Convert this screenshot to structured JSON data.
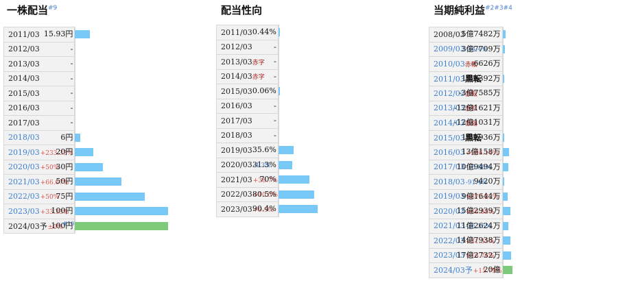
{
  "dividend": {
    "title": "一株配当",
    "title_note": "#9",
    "rows": [
      {
        "year": "2011/03",
        "value": "15.93円",
        "frac": 0.16,
        "blue": false
      },
      {
        "year": "2012/03",
        "value": "-",
        "frac": 0,
        "blue": false
      },
      {
        "year": "2013/03",
        "value": "-",
        "frac": 0,
        "blue": false
      },
      {
        "year": "2014/03",
        "value": "-",
        "frac": 0,
        "blue": false
      },
      {
        "year": "2015/03",
        "value": "-",
        "frac": 0,
        "blue": false
      },
      {
        "year": "2016/03",
        "value": "-",
        "frac": 0,
        "blue": false
      },
      {
        "year": "2017/03",
        "value": "-",
        "frac": 0,
        "blue": false
      },
      {
        "year": "2018/03",
        "value": "6円",
        "frac": 0.06,
        "blue": true
      },
      {
        "year": "2019/03",
        "change": "+233.33%",
        "dir": "up",
        "value": "20円",
        "frac": 0.2,
        "blue": true
      },
      {
        "year": "2020/03",
        "change": "+50%",
        "dir": "up",
        "value": "30円",
        "frac": 0.3,
        "blue": true
      },
      {
        "year": "2021/03",
        "change": "+66.67%",
        "dir": "up",
        "value": "50円",
        "frac": 0.5,
        "blue": true
      },
      {
        "year": "2022/03",
        "change": "+50%",
        "dir": "up",
        "value": "75円",
        "frac": 0.75,
        "blue": true
      },
      {
        "year": "2023/03",
        "change": "+33.33%",
        "dir": "up",
        "value": "100円",
        "frac": 1.0,
        "blue": true
      },
      {
        "year": "2024/03",
        "forecast_mark": "予",
        "change": "±0%",
        "dir": "up",
        "note": "#10",
        "value": "100円",
        "frac": 1.0,
        "blue": false,
        "forecast": true
      }
    ]
  },
  "payout": {
    "title": "配当性向",
    "rows": [
      {
        "year": "2011/03",
        "value": "0.44%",
        "frac": 0.005
      },
      {
        "year": "2012/03",
        "value": "-",
        "frac": 0
      },
      {
        "year": "2013/03",
        "tag": "赤字",
        "value": "-",
        "frac": 0
      },
      {
        "year": "2014/03",
        "tag": "赤字",
        "value": "-",
        "frac": 0
      },
      {
        "year": "2015/03",
        "value": "0.06%",
        "frac": 0.001
      },
      {
        "year": "2016/03",
        "value": "-",
        "frac": 0
      },
      {
        "year": "2017/03",
        "value": "-",
        "frac": 0
      },
      {
        "year": "2018/03",
        "value": "-",
        "frac": 0
      },
      {
        "year": "2019/03",
        "value": "35.6%",
        "frac": 0.16
      },
      {
        "year": "2020/03",
        "change": "-4.3%",
        "dir": "down",
        "value": "31.3%",
        "frac": 0.14
      },
      {
        "year": "2021/03",
        "change": "+38.7%",
        "dir": "up",
        "value": "70%",
        "frac": 0.32
      },
      {
        "year": "2022/03",
        "change": "+10.5%",
        "dir": "up",
        "value": "80.5%",
        "frac": 0.37
      },
      {
        "year": "2023/03",
        "change": "+9.9%",
        "dir": "up",
        "value": "90.4%",
        "frac": 0.41
      }
    ]
  },
  "net_income": {
    "title": "当期純利益",
    "title_note": "#2#3#4",
    "rows": [
      {
        "year": "2008/03",
        "value": "5億7482万",
        "frac": 0.03,
        "blue": false
      },
      {
        "year": "2009/03",
        "change": "-34.4%",
        "dir": "down",
        "value": "3億7709万",
        "frac": 0.02,
        "blue": true
      },
      {
        "year": "2010/03",
        "tag": "赤転",
        "value": "-6626万",
        "frac": 0,
        "blue": true
      },
      {
        "year": "2011/03",
        "tag": "黒転",
        "tag_big": true,
        "value": "1億8392万",
        "frac": 0.01,
        "blue": true
      },
      {
        "year": "2012/03",
        "tag": "赤転",
        "value": "-3億7585万",
        "frac": 0,
        "blue": true
      },
      {
        "year": "2013/03",
        "tag": "赤拡",
        "value": "-12億1621万",
        "frac": 0,
        "blue": true
      },
      {
        "year": "2014/03",
        "tag": "赤縮",
        "value": "-12億1031万",
        "frac": 0,
        "blue": true
      },
      {
        "year": "2015/03",
        "tag": "黒転",
        "tag_big": true,
        "value": "1億2936万",
        "frac": 0.01,
        "blue": true
      },
      {
        "year": "2016/03",
        "change": "+906.14%",
        "dir": "up",
        "value": "13億158万",
        "frac": 0.065,
        "blue": true
      },
      {
        "year": "2017/03",
        "change": "-15.88%",
        "dir": "down",
        "value": "10億9494万",
        "frac": 0.055,
        "blue": true
      },
      {
        "year": "2018/03",
        "change": "-91.4%",
        "dir": "down",
        "value": "9420万",
        "frac": 0.005,
        "blue": true
      },
      {
        "year": "2019/03",
        "change": "+872.82%",
        "dir": "up",
        "value": "9億1644万",
        "frac": 0.046,
        "blue": true
      },
      {
        "year": "2020/03",
        "change": "+66.88%",
        "dir": "up",
        "value": "15億2939万",
        "frac": 0.076,
        "blue": true
      },
      {
        "year": "2021/03",
        "change": "-26.36%",
        "dir": "down",
        "value": "11億2624万",
        "frac": 0.056,
        "blue": true
      },
      {
        "year": "2022/03",
        "change": "+31.35%",
        "dir": "up",
        "value": "14億7938万",
        "frac": 0.074,
        "blue": true
      },
      {
        "year": "2023/03",
        "change": "+16.76%",
        "dir": "up",
        "value": "17億2732万",
        "frac": 0.086,
        "blue": true
      },
      {
        "year": "2024/03",
        "forecast_mark": "予",
        "change": "+15.79%",
        "dir": "up",
        "value": "20億",
        "frac": 0.1,
        "blue": true,
        "forecast": true
      }
    ]
  }
}
